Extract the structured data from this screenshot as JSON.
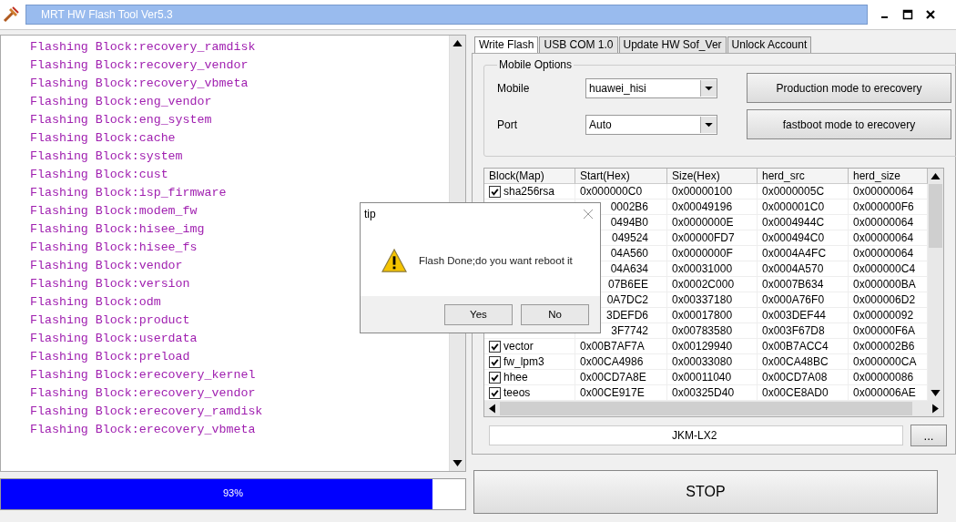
{
  "window": {
    "title": "MRT HW Flash Tool Ver5.3"
  },
  "log": [
    "Flashing Block:recovery_ramdisk",
    "Flashing Block:recovery_vendor",
    "Flashing Block:recovery_vbmeta",
    "Flashing Block:eng_vendor",
    "Flashing Block:eng_system",
    "Flashing Block:cache",
    "Flashing Block:system",
    "Flashing Block:cust",
    "Flashing Block:isp_firmware",
    "Flashing Block:modem_fw",
    "Flashing Block:hisee_img",
    "Flashing Block:hisee_fs",
    "Flashing Block:vendor",
    "Flashing Block:version",
    "Flashing Block:odm",
    "Flashing Block:product",
    "Flashing Block:userdata",
    "Flashing Block:preload",
    "Flashing Block:erecovery_kernel",
    "Flashing Block:erecovery_vendor",
    "Flashing Block:erecovery_ramdisk",
    "Flashing Block:erecovery_vbmeta"
  ],
  "progress": {
    "level": 0.93,
    "reading": "93%"
  },
  "tabs": [
    {
      "label": "Write Flash",
      "selected": true
    },
    {
      "label": "USB COM 1.0",
      "selected": false
    },
    {
      "label": "Update HW Sof_Ver",
      "selected": false
    },
    {
      "label": "Unlock Account",
      "selected": false
    }
  ],
  "mobile_options": {
    "title": "Mobile Options",
    "mobile_label": "Mobile",
    "mobile_value": "huawei_hisi",
    "port_label": "Port",
    "port_value": "Auto",
    "buttons": [
      "Production mode to erecovery",
      "fastboot mode to erecovery"
    ]
  },
  "table": {
    "columns": [
      "Block(Map)",
      "Start(Hex)",
      "Size(Hex)",
      "herd_src",
      "herd_size"
    ],
    "rows": [
      {
        "checked": true,
        "covered": false,
        "cells": [
          "sha256rsa",
          "0x000000C0",
          "0x00000100",
          "0x0000005C",
          "0x00000064"
        ]
      },
      {
        "covered": true,
        "cells": [
          "",
          "0002B6",
          "0x00049196",
          "0x000001C0",
          "0x000000F6"
        ]
      },
      {
        "covered": true,
        "cells": [
          "",
          "0494B0",
          "0x0000000E",
          "0x0004944C",
          "0x00000064"
        ]
      },
      {
        "covered": true,
        "cells": [
          "",
          "049524",
          "0x00000FD7",
          "0x000494C0",
          "0x00000064"
        ]
      },
      {
        "covered": true,
        "cells": [
          "",
          "04A560",
          "0x0000000F",
          "0x0004A4FC",
          "0x00000064"
        ]
      },
      {
        "covered": true,
        "cells": [
          "",
          "04A634",
          "0x00031000",
          "0x0004A570",
          "0x000000C4"
        ]
      },
      {
        "covered": true,
        "cells": [
          "",
          "07B6EE",
          "0x0002C000",
          "0x0007B634",
          "0x000000BA"
        ]
      },
      {
        "covered": true,
        "cells": [
          "",
          "0A7DC2",
          "0x00337180",
          "0x000A76F0",
          "0x000006D2"
        ]
      },
      {
        "covered": true,
        "cells": [
          "",
          "3DEFD6",
          "0x00017800",
          "0x003DEF44",
          "0x00000092"
        ]
      },
      {
        "covered": true,
        "cells": [
          "",
          "3F7742",
          "0x00783580",
          "0x003F67D8",
          "0x00000F6A"
        ]
      },
      {
        "checked": true,
        "covered": false,
        "cells": [
          "vector",
          "0x00B7AF7A",
          "0x00129940",
          "0x00B7ACC4",
          "0x000002B6"
        ]
      },
      {
        "checked": true,
        "covered": false,
        "cells": [
          "fw_lpm3",
          "0x00CA4986",
          "0x00033080",
          "0x00CA48BC",
          "0x000000CA"
        ]
      },
      {
        "checked": true,
        "covered": false,
        "cells": [
          "hhee",
          "0x00CD7A8E",
          "0x00011040",
          "0x00CD7A08",
          "0x00000086"
        ]
      },
      {
        "checked": true,
        "covered": false,
        "cells": [
          "teeos",
          "0x00CE917E",
          "0x00325D40",
          "0x00CE8AD0",
          "0x000006AE"
        ]
      }
    ]
  },
  "path_field": {
    "value": "JKM-LX2"
  },
  "browse_button": "...",
  "stop_button": "STOP",
  "dialog": {
    "title": "tip",
    "message": "Flash Done;do you want reboot it",
    "buttons": [
      "Yes",
      "No"
    ]
  }
}
